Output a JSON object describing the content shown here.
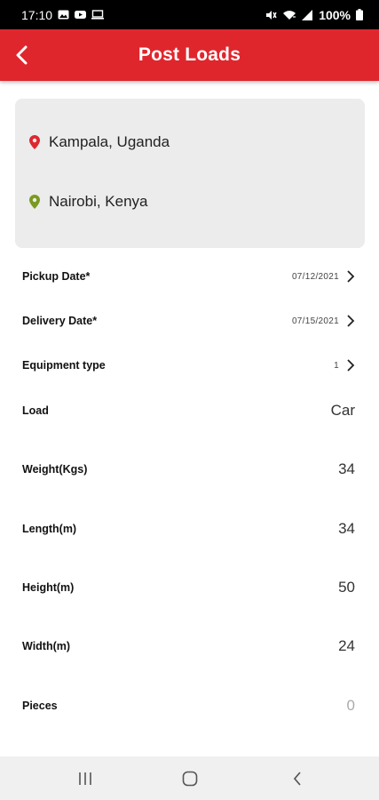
{
  "status_bar": {
    "time": "17:10",
    "battery": "100%"
  },
  "header": {
    "title": "Post Loads",
    "back_icon": "chevron-left-icon"
  },
  "route": {
    "origin": "Kampala, Uganda",
    "origin_icon": "map-pin-icon",
    "origin_color": "#e0262d",
    "destination": "Nairobi, Kenya",
    "destination_icon": "map-pin-icon",
    "destination_color": "#7a9a1f"
  },
  "form": {
    "pickup_date": {
      "label": "Pickup Date*",
      "value": "07/12/2021"
    },
    "delivery_date": {
      "label": "Delivery Date*",
      "value": "07/15/2021"
    },
    "equipment_type": {
      "label": "Equipment type",
      "value": "1"
    },
    "load": {
      "label": "Load",
      "value": "Car"
    },
    "weight": {
      "label": "Weight(Kgs)",
      "value": "34"
    },
    "length": {
      "label": "Length(m)",
      "value": "34"
    },
    "height": {
      "label": "Height(m)",
      "value": "50"
    },
    "width": {
      "label": "Width(m)",
      "value": "24"
    },
    "pieces": {
      "label": "Pieces",
      "placeholder": "0"
    }
  },
  "colors": {
    "accent": "#e0262d",
    "card_bg": "#ececec"
  }
}
